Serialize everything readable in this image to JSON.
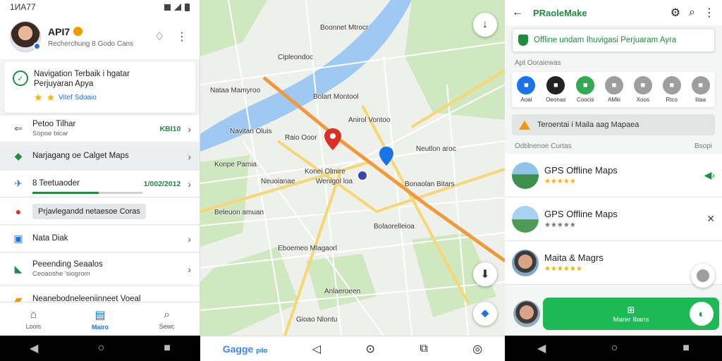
{
  "left": {
    "status": {
      "time": "1ИА77"
    },
    "profile": {
      "name": "API7",
      "subtitle": "Recherchung 8 Godo Cans"
    },
    "promo": {
      "line1": "Navigation Terbaik i hgatar",
      "line2": "Perjuyaran Apya",
      "rating": "Vitef Sdoaio"
    },
    "menu": [
      {
        "label": "Petoo Tilhar",
        "sub": "Sopoe bicar",
        "value": "KBI10",
        "icon": "back-arrow-icon"
      },
      {
        "label": "Narjagang oe Calget Maps",
        "sub": "",
        "value": "",
        "icon": "diamond-icon"
      },
      {
        "label": "8 Teetuaoder",
        "sub": "",
        "value": "1/002/2012",
        "icon": "plane-icon"
      },
      {
        "label": "Prjavlegandd netaesoe Coras",
        "sub": "",
        "value": "",
        "icon": "record-icon"
      },
      {
        "label": "Nata Diak",
        "sub": "",
        "value": "",
        "icon": "square-icon"
      },
      {
        "label": "Peeending Seaalos",
        "sub": "Ceoaoshe 'siogrom",
        "value": "",
        "icon": "arrow-down-icon"
      },
      {
        "label": "Neanebodneleeniinneet Voeal",
        "sub": "",
        "value": "",
        "icon": "folder-icon"
      }
    ],
    "progress": 0.6,
    "nav": [
      {
        "label": "Loois",
        "icon": "home-icon"
      },
      {
        "label": "Mairo",
        "icon": "map-icon"
      },
      {
        "label": "Sewc",
        "icon": "search-icon"
      }
    ]
  },
  "map": {
    "labels": [
      {
        "text": "Boonnet Mtrocr"
      },
      {
        "text": "Cipleondoc"
      },
      {
        "text": "Nataa Mamyroo"
      },
      {
        "text": "Anirol Vontoo"
      },
      {
        "text": "Bolart Montool"
      },
      {
        "text": "Raio Ooor"
      },
      {
        "text": "Neutlon aroc"
      },
      {
        "text": "Navitan Oluis"
      },
      {
        "text": "Konpe Pamia"
      },
      {
        "text": "Konei Olmire"
      },
      {
        "text": "Wenigol loa"
      },
      {
        "text": "Neuoianae"
      },
      {
        "text": "Beleuon amuan"
      },
      {
        "text": "Bonaolan Bitars"
      },
      {
        "text": "Eboemeo Mlagaorl"
      },
      {
        "text": "Bolaorelleioa"
      },
      {
        "text": "Anlaeroeen"
      },
      {
        "text": "Gioao Nlontu"
      }
    ],
    "logo": "Gagge",
    "logo_suffix": "pilo"
  },
  "right": {
    "header": {
      "title": "PRaoleMake"
    },
    "banner": "Offline undam Ihuvigasi  Perjuaram Ayra",
    "section1": "Apt Ooraiewas",
    "categories": [
      {
        "label": "Aoal",
        "color": "#1a73e8"
      },
      {
        "label": "Oeonas",
        "color": "#222222"
      },
      {
        "label": "Coocis",
        "color": "#34a853"
      },
      {
        "label": "AMki",
        "color": "#9e9e9e"
      },
      {
        "label": "Xoos",
        "color": "#9e9e9e"
      },
      {
        "label": "Rtco",
        "color": "#9e9e9e"
      },
      {
        "label": "Iitaa",
        "color": "#9e9e9e"
      }
    ],
    "warning": "Teroentai i Maila aag Mapaea",
    "section2": "Odtilnenoe Curtas",
    "section2_right": "Bsopi",
    "apps": [
      {
        "name": "GPS Offline Maps",
        "stars": "★★★★★"
      },
      {
        "name": "GPS Offline Maps",
        "stars": "★★★★★"
      },
      {
        "name": "Maita & Magrs",
        "stars": "★★★★★★"
      }
    ],
    "install": {
      "label": "Marer Ibans"
    }
  }
}
